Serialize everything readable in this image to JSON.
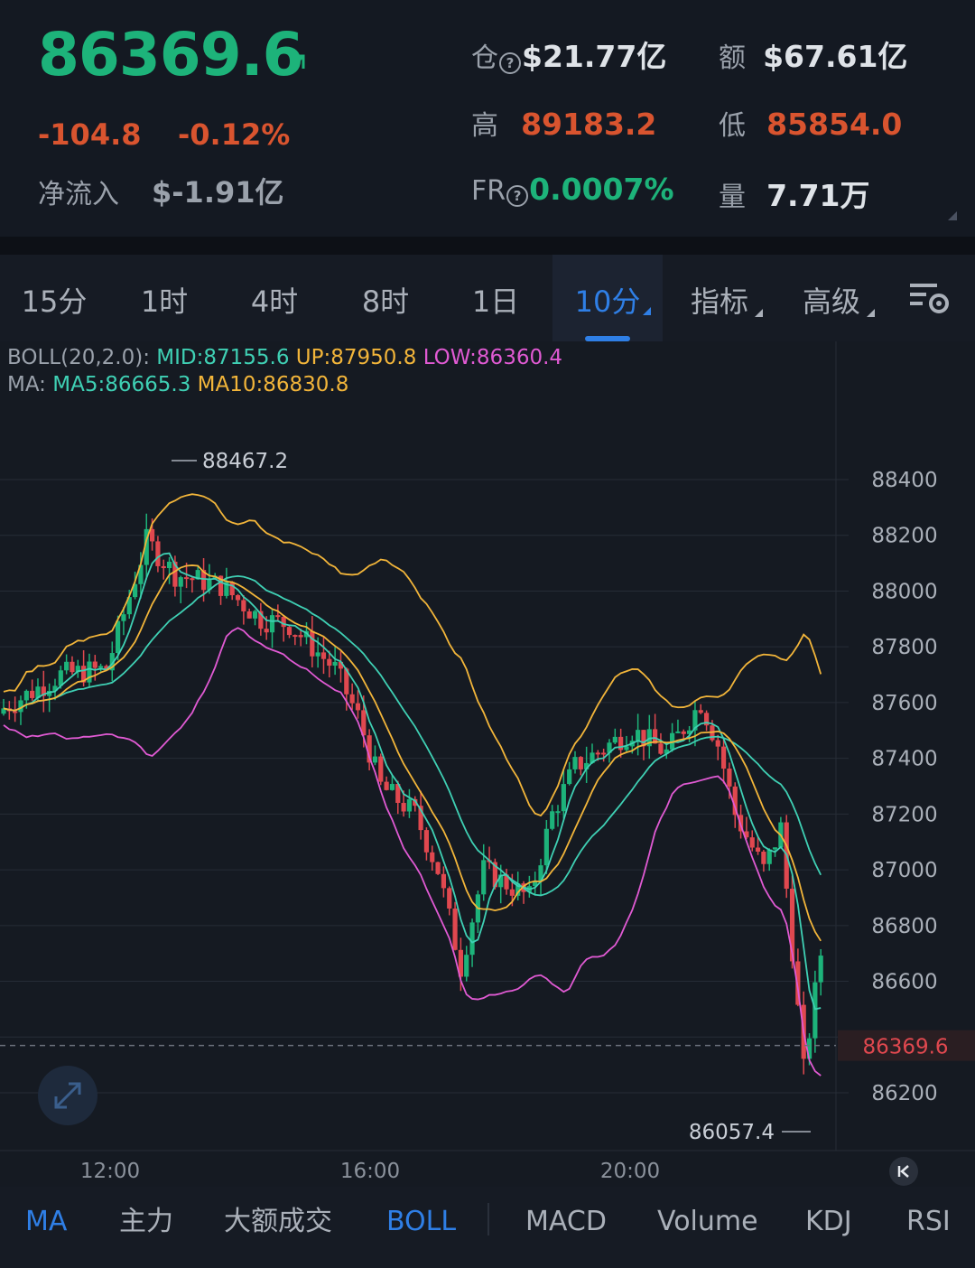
{
  "header": {
    "price": "86369.6",
    "change": "-104.8",
    "change_pct": "-0.12%",
    "inflow_label": "净流入",
    "inflow_value": "$-1.91亿",
    "open_interest_label": "仓",
    "open_interest_value": "$21.77亿",
    "amount_label": "额",
    "amount_value": "$67.61亿",
    "high_label": "高",
    "high_value": "89183.2",
    "low_label": "低",
    "low_value": "85854.0",
    "fr_label": "FR",
    "fr_value": "0.0007%",
    "volume_label": "量",
    "volume_value": "7.71万"
  },
  "tabs": [
    {
      "label": "15分"
    },
    {
      "label": "1时"
    },
    {
      "label": "4时"
    },
    {
      "label": "8时"
    },
    {
      "label": "1日"
    },
    {
      "label": "10分",
      "active": true
    },
    {
      "label": "指标"
    },
    {
      "label": "高级"
    }
  ],
  "indicators": {
    "boll_prefix": "BOLL(20,2.0):",
    "mid": "MID:87155.6",
    "up": "UP:87950.8",
    "low": "LOW:86360.4",
    "ma_prefix": "MA:",
    "ma5": "MA5:86665.3",
    "ma10": "MA10:86830.8"
  },
  "chart_data": {
    "type": "candlestick",
    "y_ticks": [
      "88400",
      "88200",
      "88000",
      "87800",
      "87600",
      "87400",
      "87200",
      "87000",
      "86800",
      "86600",
      "86200"
    ],
    "x_ticks": [
      "12:00",
      "16:00",
      "20:00"
    ],
    "last_price_label": "86369.6",
    "max_label": "88467.2",
    "min_label": "86057.4",
    "ylim": [
      86100,
      88600
    ],
    "colors": {
      "up": "#1db37a",
      "down": "#e0484f",
      "mid": "#3fd0b4",
      "upper": "#f2b53a",
      "lower": "#e05ad3"
    }
  },
  "bottom_nav": [
    {
      "label": "MA",
      "active": true
    },
    {
      "label": "主力"
    },
    {
      "label": "大额成交"
    },
    {
      "label": "BOLL",
      "active": true
    },
    {
      "label": "MACD"
    },
    {
      "label": "Volume"
    },
    {
      "label": "KDJ"
    },
    {
      "label": "RSI"
    }
  ]
}
